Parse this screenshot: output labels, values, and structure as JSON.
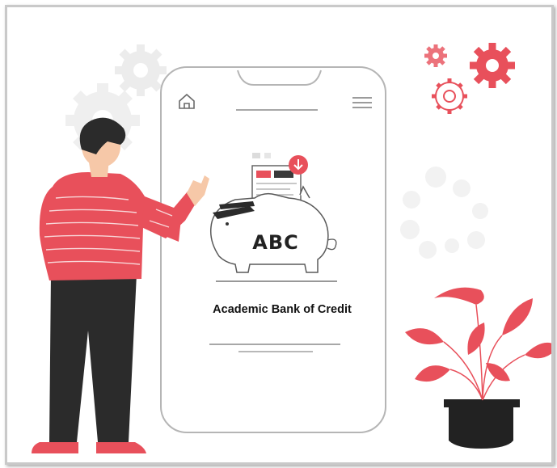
{
  "logo_text": "ABC",
  "bank_name": "Academic Bank of Credit",
  "colors": {
    "accent": "#e8505b",
    "gear_gray": "#e6e6e6",
    "outline": "#5a5a5a",
    "trousers": "#2b2b2b",
    "pot": "#222222"
  },
  "icons": [
    "home-icon",
    "hamburger-menu-icon",
    "download-icon",
    "gear-icon"
  ]
}
